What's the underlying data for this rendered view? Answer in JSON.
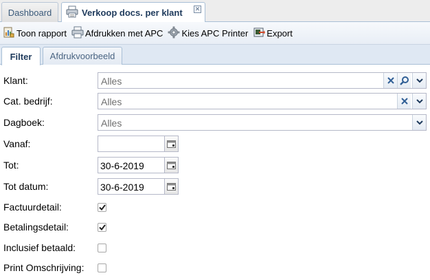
{
  "tabs": {
    "dashboard": "Dashboard",
    "report": "Verkoop docs. per klant",
    "close": "✕"
  },
  "toolbar": {
    "show_report": "Toon rapport",
    "print_apc": "Afdrukken met APC",
    "choose_printer": "Kies APC Printer",
    "export": "Export"
  },
  "subtabs": {
    "filter": "Filter",
    "preview": "Afdrukvoorbeeld"
  },
  "form": {
    "klant": {
      "label": "Klant:",
      "value": "Alles"
    },
    "cat_bedrijf": {
      "label": "Cat. bedrijf:",
      "value": "Alles"
    },
    "dagboek": {
      "label": "Dagboek:",
      "value": "Alles"
    },
    "vanaf": {
      "label": "Vanaf:",
      "value": ""
    },
    "tot": {
      "label": "Tot:",
      "value": "30-6-2019"
    },
    "tot_datum": {
      "label": "Tot datum:",
      "value": "30-6-2019"
    },
    "factuurdetail": {
      "label": "Factuurdetail:",
      "checked": true
    },
    "betalingsdetail": {
      "label": "Betalingsdetail:",
      "checked": true
    },
    "inclusief_betaald": {
      "label": "Inclusief betaald:",
      "checked": false
    },
    "print_omschrijving": {
      "label": "Print Omschrijving:",
      "checked": false
    }
  },
  "colors": {
    "accent": "#1e3a5c",
    "border": "#a9bfd6",
    "toolbar_bg": "#e8eef6"
  }
}
